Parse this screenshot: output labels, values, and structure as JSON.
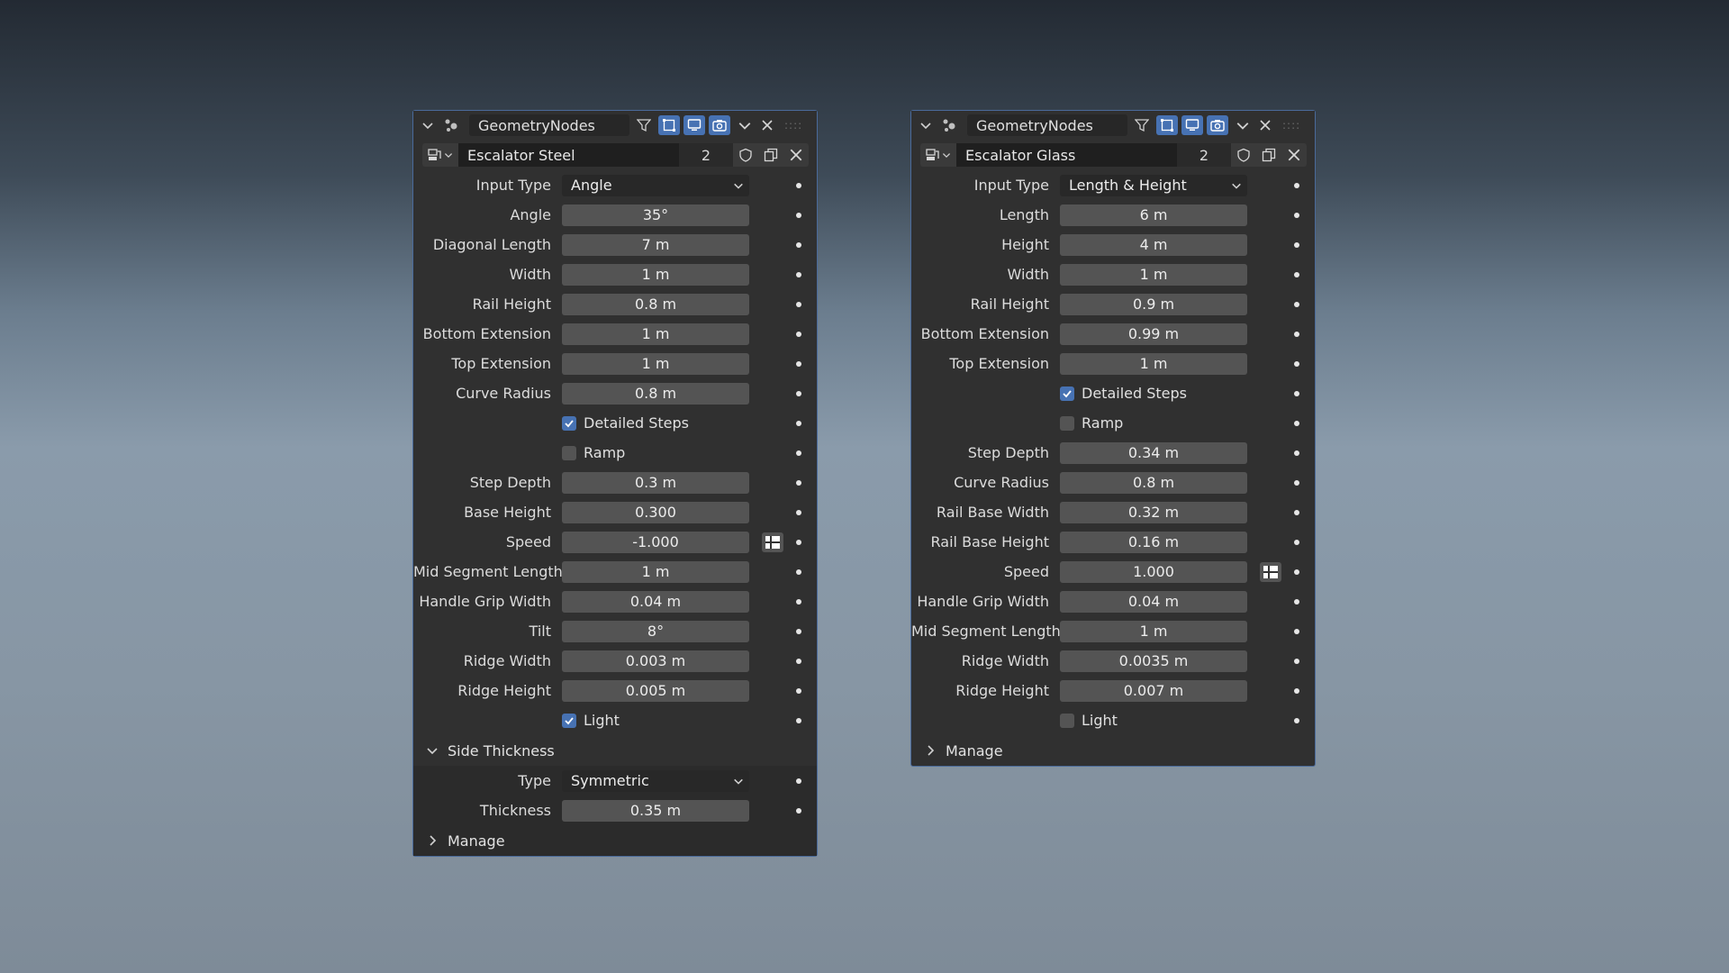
{
  "panels": {
    "left": {
      "modifier_name": "GeometryNodes",
      "nodegroup": {
        "name": "Escalator Steel",
        "users": "2"
      },
      "input_type": {
        "label": "Input Type",
        "value": "Angle"
      },
      "rows": [
        {
          "label": "Angle",
          "value": "35°"
        },
        {
          "label": "Diagonal Length",
          "value": "7 m"
        },
        {
          "label": "Width",
          "value": "1 m"
        },
        {
          "label": "Rail Height",
          "value": "0.8 m"
        },
        {
          "label": "Bottom Extension",
          "value": "1 m"
        },
        {
          "label": "Top Extension",
          "value": "1 m"
        },
        {
          "label": "Curve Radius",
          "value": "0.8 m"
        }
      ],
      "detailed_steps": {
        "label": "Detailed Steps",
        "checked": true
      },
      "ramp": {
        "label": "Ramp",
        "checked": false
      },
      "rows2": [
        {
          "label": "Step Depth",
          "value": "0.3 m"
        },
        {
          "label": "Base Height",
          "value": "0.300"
        }
      ],
      "speed": {
        "label": "Speed",
        "value": "-1.000"
      },
      "rows3": [
        {
          "label": "Mid Segment Length",
          "value": "1 m"
        },
        {
          "label": "Handle Grip Width",
          "value": "0.04 m"
        },
        {
          "label": "Tilt",
          "value": "8°"
        },
        {
          "label": "Ridge Width",
          "value": "0.003 m"
        },
        {
          "label": "Ridge Height",
          "value": "0.005 m"
        }
      ],
      "light": {
        "label": "Light",
        "checked": true
      },
      "side_thickness": {
        "label": "Side Thickness",
        "type": {
          "label": "Type",
          "value": "Symmetric"
        },
        "thickness": {
          "label": "Thickness",
          "value": "0.35 m"
        }
      },
      "manage_label": "Manage"
    },
    "right": {
      "modifier_name": "GeometryNodes",
      "nodegroup": {
        "name": "Escalator Glass",
        "users": "2"
      },
      "input_type": {
        "label": "Input Type",
        "value": "Length & Height"
      },
      "rows": [
        {
          "label": "Length",
          "value": "6 m"
        },
        {
          "label": "Height",
          "value": "4 m"
        },
        {
          "label": "Width",
          "value": "1 m"
        },
        {
          "label": "Rail Height",
          "value": "0.9 m"
        },
        {
          "label": "Bottom Extension",
          "value": "0.99 m"
        },
        {
          "label": "Top Extension",
          "value": "1 m"
        }
      ],
      "detailed_steps": {
        "label": "Detailed Steps",
        "checked": true
      },
      "ramp": {
        "label": "Ramp",
        "checked": false
      },
      "rows2": [
        {
          "label": "Step Depth",
          "value": "0.34 m"
        },
        {
          "label": "Curve Radius",
          "value": "0.8 m"
        },
        {
          "label": "Rail Base Width",
          "value": "0.32 m"
        },
        {
          "label": "Rail Base Height",
          "value": "0.16 m"
        }
      ],
      "speed": {
        "label": "Speed",
        "value": "1.000"
      },
      "rows3": [
        {
          "label": "Handle Grip Width",
          "value": "0.04 m"
        },
        {
          "label": "Mid Segment Length",
          "value": "1 m"
        },
        {
          "label": "Ridge Width",
          "value": "0.0035 m"
        },
        {
          "label": "Ridge Height",
          "value": "0.007 m"
        }
      ],
      "light": {
        "label": "Light",
        "checked": false
      },
      "manage_label": "Manage"
    }
  },
  "colors": {
    "accent": "#4772b3",
    "panel": "#303030",
    "field": "#545454"
  }
}
